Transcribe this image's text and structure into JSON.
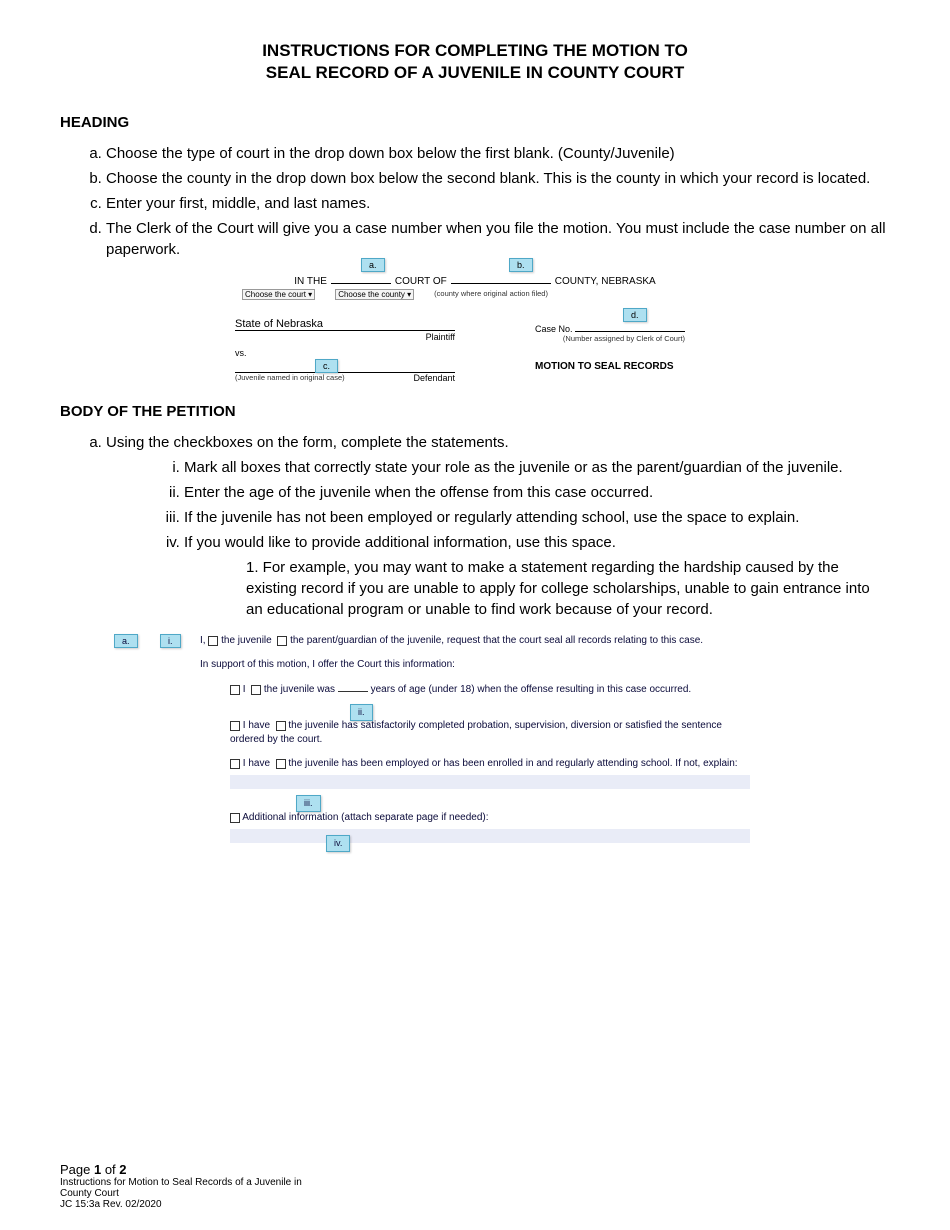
{
  "title_line1": "INSTRUCTIONS FOR COMPLETING THE MOTION TO",
  "title_line2": "SEAL RECORD OF A JUVENILE IN COUNTY COURT",
  "heading1": "HEADING",
  "heading_items": {
    "a": "Choose the type of court in the drop down box below the first blank. (County/Juvenile)",
    "b": "Choose the county in the drop down box below the second blank. This is the county in which your record is located.",
    "c": "Enter your first, middle, and last names.",
    "d": "The Clerk of the Court will give you a case number when you file the motion. You must include the case number on all paperwork."
  },
  "form": {
    "in_the": "IN THE",
    "court_of": "COURT OF",
    "county_ne": "COUNTY, NEBRASKA",
    "choose_court": "Choose the court ▾",
    "choose_county": "Choose the county ▾",
    "county_where": "(county where original action filed)",
    "state": "State of  Nebraska",
    "plaintiff": "Plaintiff",
    "vs": "vs.",
    "juvenile_named": "(Juvenile named in original case)",
    "defendant": "Defendant",
    "case_no": "Case No.",
    "number_assigned": "(Number assigned by Clerk of Court)",
    "motion_title": "MOTION TO SEAL RECORDS"
  },
  "callouts": {
    "a": "a.",
    "b": "b.",
    "c": "c.",
    "d": "d.",
    "i": "i.",
    "ii": "ii.",
    "iii": "iii.",
    "iv": "iv."
  },
  "heading2": "BODY OF THE PETITION",
  "body_a": "Using the checkboxes on the form, complete the statements.",
  "body_roman": {
    "i": "Mark all boxes that correctly state your role as the juvenile or as the parent/guardian of the juvenile.",
    "ii": "Enter the age of the juvenile when the offense from this case occurred.",
    "iii": "If the juvenile has not been employed or regularly attending school, use the space to explain.",
    "iv": "If you would like to provide additional information, use this space."
  },
  "body_sub1": "1.  For example, you may want to make a statement regarding the hardship caused by the existing record if you are unable to apply for college scholarships, unable to gain entrance into an educational program or unable to find work because of your record.",
  "petition": {
    "line1_pre": "I,",
    "line1_juv": "the juvenile",
    "line1_parent": "the parent/guardian of the juvenile, request that the court seal all records relating to this case.",
    "support": "In support of this motion, I offer the Court this information:",
    "line2_pre": "I",
    "line2_juv": "the juvenile was",
    "line2_post": "years of age (under 18) when the offense resulting in this case occurred.",
    "line3_pre": "I have",
    "line3_juv": "the juvenile has satisfactorily completed probation, supervision, diversion or satisfied the sentence ordered by the court.",
    "line4_pre": "I have",
    "line4_juv": "the juvenile has been employed or has been enrolled in and regularly attending school.  If not, explain:",
    "line5": "Additional information (attach separate page if needed):"
  },
  "footer": {
    "page": "Page ",
    "page_num": "1",
    "of": " of ",
    "total": "2",
    "line2": "Instructions for Motion to Seal Records of a Juvenile in",
    "line3": "County Court",
    "line4": "JC 15:3a Rev. 02/2020"
  }
}
